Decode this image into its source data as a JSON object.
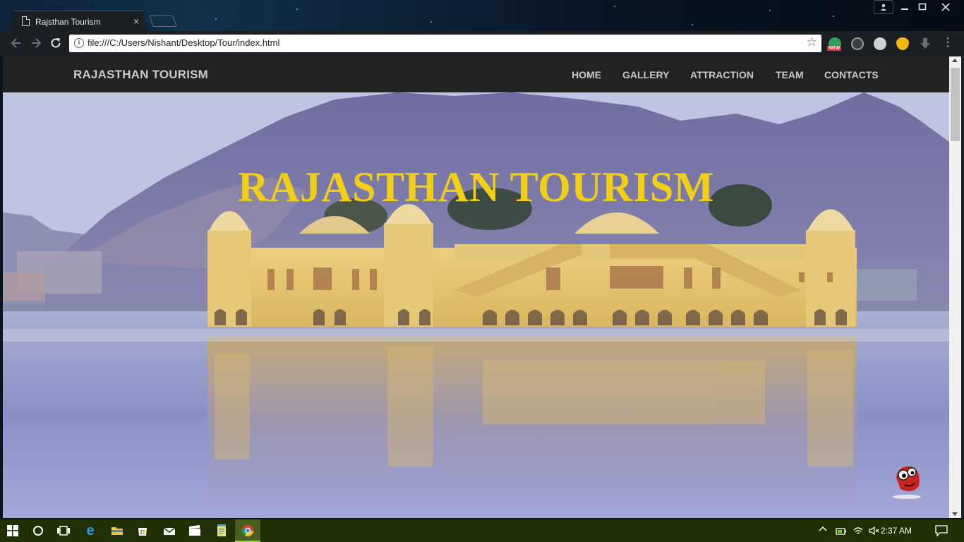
{
  "browser": {
    "tab_title": "Rajsthan Tourism",
    "tab_close": "×",
    "url": "file:///C:/Users/Nishant/Desktop/Tour/index.html",
    "extension_badge": "NEW",
    "window_controls": [
      "minimize",
      "maximize",
      "close"
    ]
  },
  "site": {
    "brand": "RAJASTHAN TOURISM",
    "nav": [
      {
        "label": "HOME"
      },
      {
        "label": "GALLERY"
      },
      {
        "label": "ATTRACTION"
      },
      {
        "label": "TEAM"
      },
      {
        "label": "CONTACTS"
      }
    ],
    "hero_title": "RAJASTHAN TOURISM",
    "hero_image": "jal-mahal-lake-palace",
    "accent_color": "#f2cf17"
  },
  "taskbar": {
    "clock": "2:37 AM",
    "pinned": [
      "windows-start-icon",
      "cortana-icon",
      "task-view-icon",
      "edge-icon",
      "file-explorer-icon",
      "store-icon",
      "mail-icon",
      "movies-icon",
      "notepad-icon",
      "chrome-icon"
    ]
  }
}
